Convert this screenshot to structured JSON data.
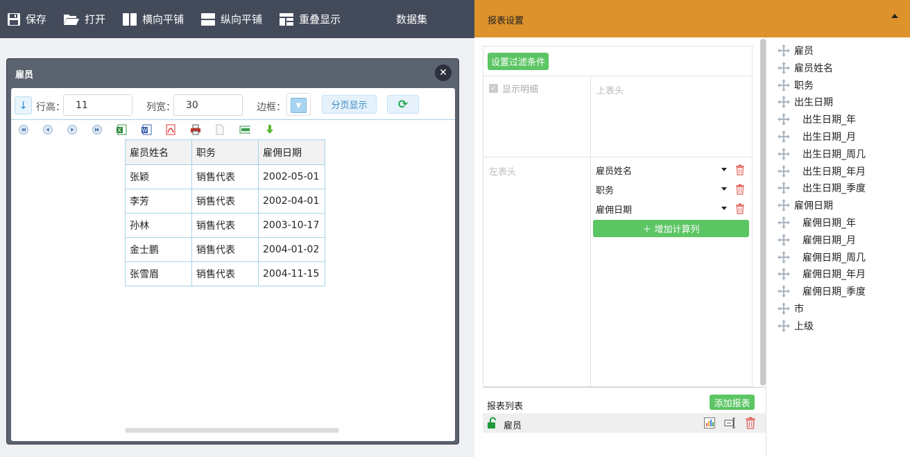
{
  "toolbar": {
    "save_label": "保存",
    "open_label": "打开",
    "horizontal_label": "横向平铺",
    "vertical_label": "纵向平铺",
    "overlap_label": "重叠显示",
    "dataset_label": "数据集"
  },
  "window": {
    "title": "雇员",
    "close_symbol": "✕",
    "sort_symbol": "↓",
    "row_height_label": "行高：",
    "row_height_value": "11",
    "col_width_label": "列宽：",
    "col_width_value": "30",
    "border_label": "边框：",
    "page_button": "分页显示",
    "refresh_symbol": "⟳",
    "table": {
      "headers": [
        "雇员姓名",
        "职务",
        "雇佣日期"
      ],
      "rows": [
        [
          "张颖",
          "销售代表",
          "2002-05-01"
        ],
        [
          "李芳",
          "销售代表",
          "2002-04-01"
        ],
        [
          "孙林",
          "销售代表",
          "2003-10-17"
        ],
        [
          "金士鹏",
          "销售代表",
          "2004-01-02"
        ],
        [
          "张雪眉",
          "销售代表",
          "2004-11-15"
        ]
      ]
    }
  },
  "settings": {
    "title": "报表设置",
    "filter_button": "设置过滤条件",
    "show_detail_label": "显示明细",
    "top_header_placeholder": "上表头",
    "left_header_placeholder": "左表头",
    "columns": [
      "雇员姓名",
      "职务",
      "雇佣日期"
    ],
    "add_calc_button": "＋ 增加计算列",
    "report_list_title": "报表列表",
    "add_report_button": "添加报表",
    "report_item": "雇员"
  },
  "fields": [
    {
      "label": "雇员",
      "indent": 0
    },
    {
      "label": "雇员姓名",
      "indent": 0
    },
    {
      "label": "职务",
      "indent": 0
    },
    {
      "label": "出生日期",
      "indent": 0
    },
    {
      "label": "出生日期_年",
      "indent": 1
    },
    {
      "label": "出生日期_月",
      "indent": 1
    },
    {
      "label": "出生日期_周几",
      "indent": 1
    },
    {
      "label": "出生日期_年月",
      "indent": 1
    },
    {
      "label": "出生日期_季度",
      "indent": 1
    },
    {
      "label": "雇佣日期",
      "indent": 0
    },
    {
      "label": "雇佣日期_年",
      "indent": 1
    },
    {
      "label": "雇佣日期_月",
      "indent": 1
    },
    {
      "label": "雇佣日期_周几",
      "indent": 1
    },
    {
      "label": "雇佣日期_年月",
      "indent": 1
    },
    {
      "label": "雇佣日期_季度",
      "indent": 1
    },
    {
      "label": "市",
      "indent": 0
    },
    {
      "label": "上级",
      "indent": 0
    }
  ],
  "colors": {
    "toolbar_bg": "#434a5a",
    "settings_header_bg": "#dd922c",
    "green_button": "#5cc564",
    "table_border": "#a6d2e8"
  }
}
